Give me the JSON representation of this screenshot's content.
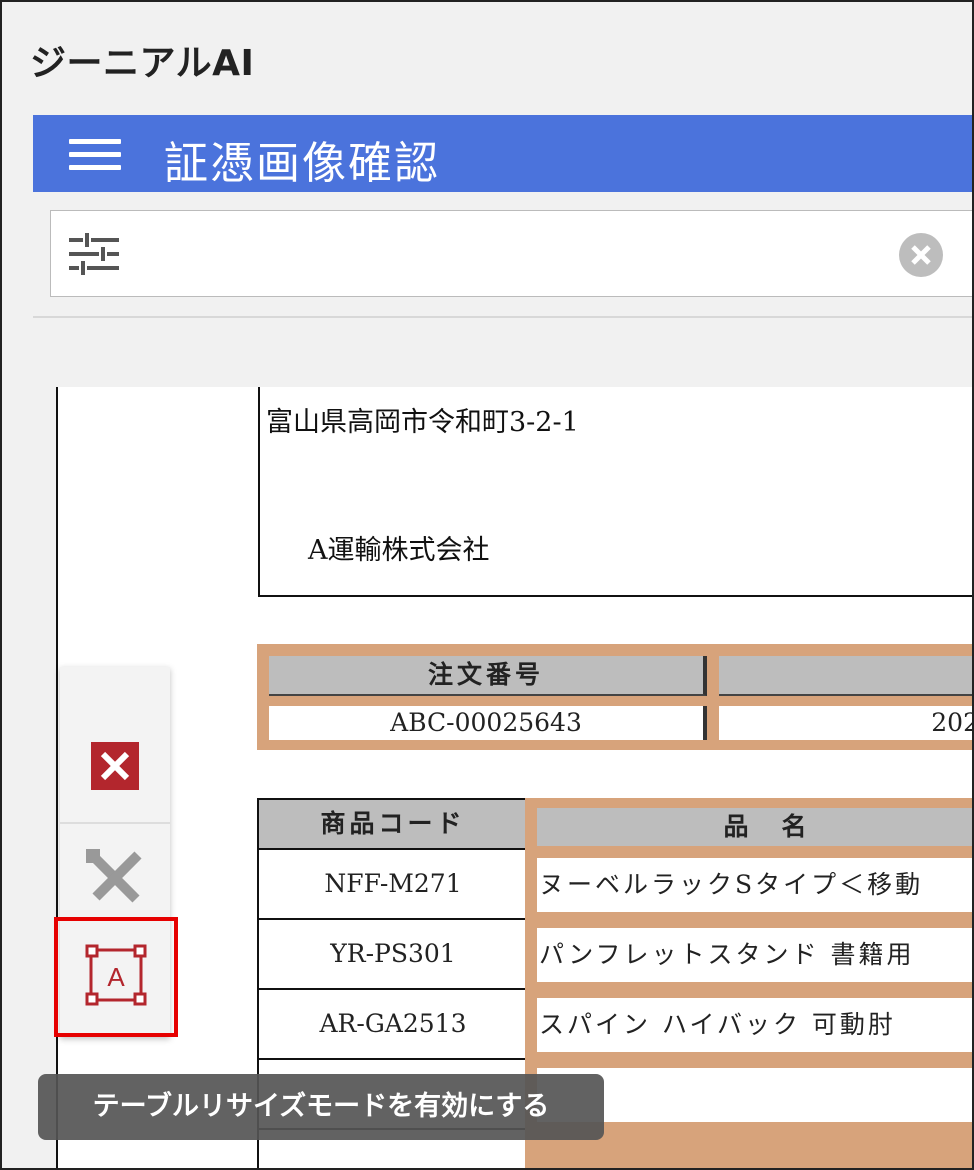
{
  "app": {
    "title": "ジーニアルAI"
  },
  "header": {
    "title": "証憑画像確認"
  },
  "filter": {
    "clear_icon": "clear-circle-icon",
    "settings_icon": "sliders-icon"
  },
  "document": {
    "address": "富山県高岡市令和町3-2-1",
    "company": "A運輸株式会社",
    "order_table": {
      "headers": [
        "注文番号",
        ""
      ],
      "row": [
        "ABC-00025643",
        "202"
      ]
    },
    "items_table": {
      "headers": [
        "商品コード",
        "品　名"
      ],
      "rows": [
        {
          "code": "NFF-M271",
          "name": "ヌーベルラックSタイプ＜移動"
        },
        {
          "code": "YR-PS301",
          "name": "パンフレットスタンド 書籍用"
        },
        {
          "code": "AR-GA2513",
          "name": "スパイン ハイバック 可動肘"
        },
        {
          "code": "",
          "name": ""
        }
      ]
    }
  },
  "toolbar": {
    "buttons": [
      {
        "name": "delete",
        "icon": "close-x-icon",
        "color": "#b3262d"
      },
      {
        "name": "edit",
        "icon": "tools-icon",
        "color": "#999999"
      },
      {
        "name": "table-resize",
        "icon": "text-frame-icon",
        "color": "#b3262d"
      }
    ],
    "tooltip": "テーブルリサイズモードを有効にする"
  },
  "colors": {
    "header": "#4b73dc",
    "table_highlight": "#d7a37b",
    "selection": "#e60000"
  }
}
